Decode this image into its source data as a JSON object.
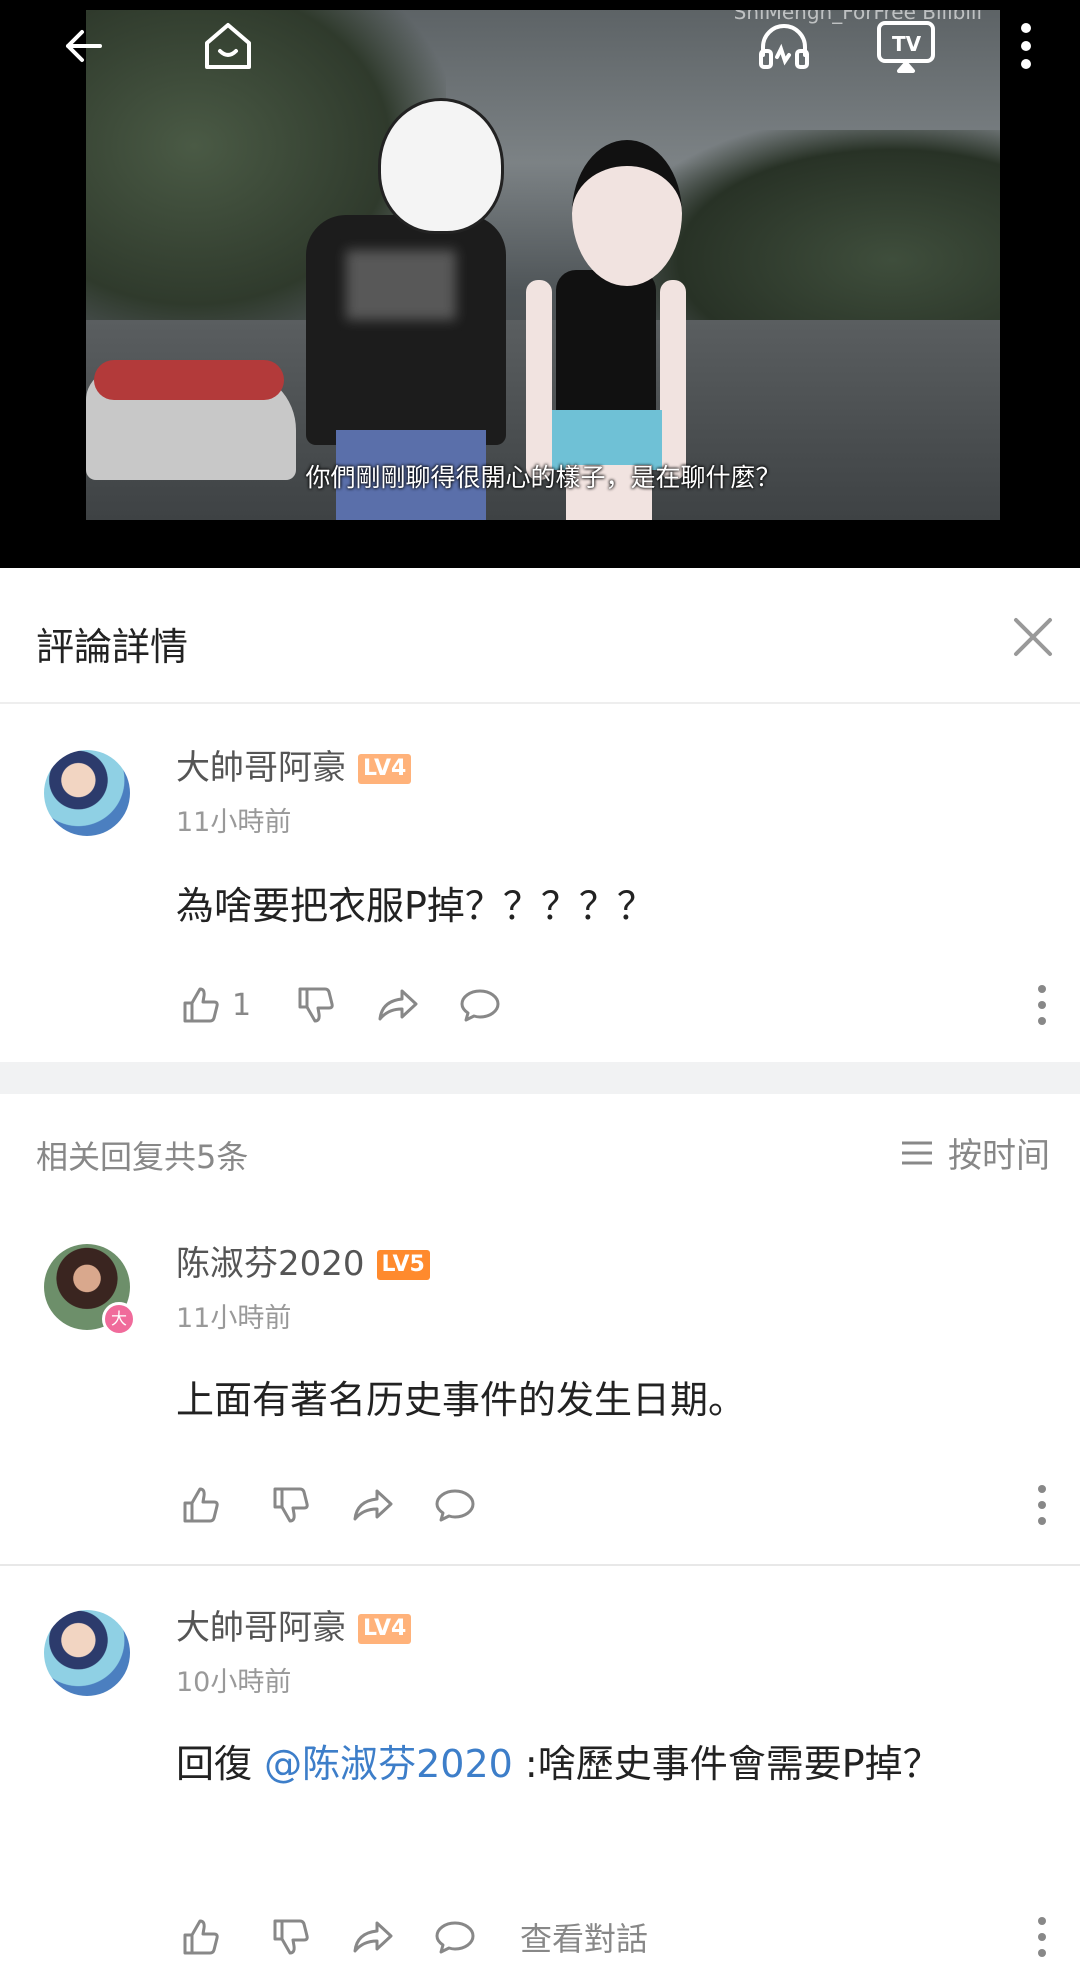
{
  "video": {
    "subtitle": "你們剛剛聊得很開心的樣子，是在聊什麼？",
    "watermark": "ShiMengh_ForFree Bilibili",
    "topbar": {
      "back_icon": "arrow-left-icon",
      "home_icon": "home-icon",
      "audio_icon": "headphones-icon",
      "cast_icon": "tv-cast-icon",
      "more_icon": "more-vertical-icon"
    }
  },
  "panel": {
    "title": "評論詳情",
    "close_icon": "close-icon"
  },
  "main_comment": {
    "username": "大帥哥阿豪",
    "level": "LV4",
    "time": "11小時前",
    "text": "為啥要把衣服P掉？？？？？",
    "like_count": "1"
  },
  "replies_header": {
    "count_label": "相关回复共5条",
    "sort_label": "按时间"
  },
  "replies": [
    {
      "username": "陈淑芬2020",
      "level": "LV5",
      "badge": "大",
      "time": "11小時前",
      "text": "上面有著名历史事件的发生日期。"
    },
    {
      "username": "大帥哥阿豪",
      "level": "LV4",
      "time": "10小時前",
      "reply_prefix": "回復 ",
      "mention": "@陈淑芬2020",
      "text_after": " :啥歷史事件會需要P掉？",
      "view_conversation": "查看對話"
    }
  ],
  "colors": {
    "accent_link": "#3d7ec9",
    "lv4": "#ffb27a",
    "lv5": "#ff8a2d",
    "badge_pink": "#f06b9b"
  }
}
